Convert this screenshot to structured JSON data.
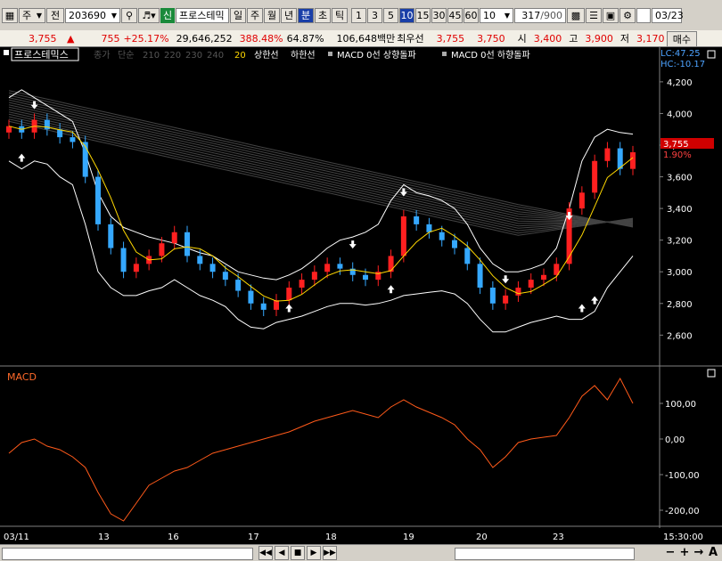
{
  "toolbar": {
    "market_select": "주",
    "type_label": "전",
    "stock_code": "203690",
    "credit_label": "신",
    "stock_name": "프로스테믹",
    "period_buttons": [
      "일",
      "주",
      "월",
      "년",
      "분",
      "초",
      "틱"
    ],
    "period_selected": "분",
    "interval_buttons": [
      "1",
      "3",
      "5",
      "10",
      "15",
      "30",
      "45",
      "60"
    ],
    "interval_selected": "10",
    "interval_value": "10",
    "count_value": "317",
    "count_total": "/900",
    "date_value": "03/23"
  },
  "quote": {
    "price": "3,755",
    "change_arrow": "▲",
    "change": "755",
    "change_pct": "+25.17%",
    "volume": "29,646,252",
    "volume_ratio": "388.48%",
    "turnover": "64.87%",
    "amount": "106,648백만",
    "best_ask_label": "최우선",
    "best_ask": "3,755",
    "best_bid": "3,750",
    "open_label": "시",
    "open": "3,400",
    "high_label": "고",
    "high": "3,900",
    "low_label": "저",
    "low": "3,170",
    "buy_button": "매수"
  },
  "chart": {
    "legend_name": "프로스테믹스",
    "legend_items": [
      "종가",
      "단순",
      "210",
      "220",
      "230",
      "240",
      "20",
      "상한선",
      "하한선",
      "MACD 0선 상향돌파",
      "MACD 0선 하향돌파"
    ],
    "lc_label": "LC:47.25",
    "hc_label": "HC:-10.17",
    "current_price_label": "3,755",
    "current_pct_label": "1.90%",
    "macd_title": "MACD",
    "price_ticks": [
      "4,200",
      "4,000",
      "3,800",
      "3,600",
      "3,400",
      "3,200",
      "3,000",
      "2,800",
      "2,600"
    ],
    "macd_ticks": [
      "100,00",
      "0,00",
      "-100,00",
      "-200,00"
    ],
    "date_ticks": [
      "03/11",
      "13",
      "16",
      "17",
      "18",
      "19",
      "20",
      "23"
    ],
    "time_label": "15:30:00"
  },
  "chart_data": [
    {
      "type": "candlestick",
      "title": "프로스테믹스",
      "ylim": [
        2450,
        4250
      ],
      "categories": [
        "03/11",
        "13",
        "16",
        "17",
        "18",
        "19",
        "20",
        "23"
      ],
      "close": [
        3920,
        3880,
        3960,
        3900,
        3850,
        3820,
        3600,
        3300,
        3150,
        3000,
        3050,
        3100,
        3180,
        3250,
        3100,
        3050,
        3000,
        2950,
        2880,
        2800,
        2760,
        2820,
        2900,
        2950,
        3000,
        3050,
        3020,
        2980,
        2950,
        3000,
        3100,
        3350,
        3300,
        3250,
        3200,
        3150,
        3050,
        2900,
        2800,
        2850,
        2900,
        2950,
        2980,
        3050,
        3400,
        3500,
        3700,
        3780,
        3650,
        3755
      ],
      "upper_band": [
        4100,
        4150,
        4100,
        4050,
        4000,
        3950,
        3750,
        3500,
        3350,
        3280,
        3250,
        3220,
        3200,
        3180,
        3150,
        3120,
        3100,
        3050,
        3000,
        2980,
        2960,
        2950,
        2980,
        3020,
        3080,
        3150,
        3200,
        3220,
        3250,
        3300,
        3450,
        3550,
        3500,
        3480,
        3450,
        3400,
        3300,
        3150,
        3050,
        3000,
        3000,
        3020,
        3050,
        3150,
        3400,
        3700,
        3850,
        3900,
        3880,
        3870
      ],
      "lower_band": [
        3700,
        3650,
        3700,
        3680,
        3600,
        3550,
        3300,
        3000,
        2900,
        2850,
        2850,
        2880,
        2900,
        2950,
        2900,
        2850,
        2820,
        2780,
        2700,
        2650,
        2640,
        2680,
        2700,
        2720,
        2750,
        2780,
        2800,
        2800,
        2790,
        2800,
        2820,
        2850,
        2860,
        2870,
        2880,
        2860,
        2800,
        2700,
        2620,
        2620,
        2650,
        2680,
        2700,
        2720,
        2700,
        2700,
        2750,
        2900,
        3000,
        3100
      ]
    },
    {
      "type": "line",
      "title": "MACD",
      "ylim": [
        -240,
        170
      ],
      "series": [
        {
          "name": "MACD",
          "values": [
            -40,
            -10,
            0,
            -20,
            -30,
            -50,
            -80,
            -150,
            -210,
            -230,
            -180,
            -130,
            -110,
            -90,
            -80,
            -60,
            -40,
            -30,
            -20,
            -10,
            0,
            10,
            20,
            35,
            50,
            60,
            70,
            80,
            70,
            60,
            90,
            110,
            90,
            75,
            60,
            40,
            0,
            -30,
            -80,
            -50,
            -10,
            0,
            5,
            10,
            60,
            120,
            150,
            110,
            170,
            100
          ]
        }
      ]
    }
  ]
}
